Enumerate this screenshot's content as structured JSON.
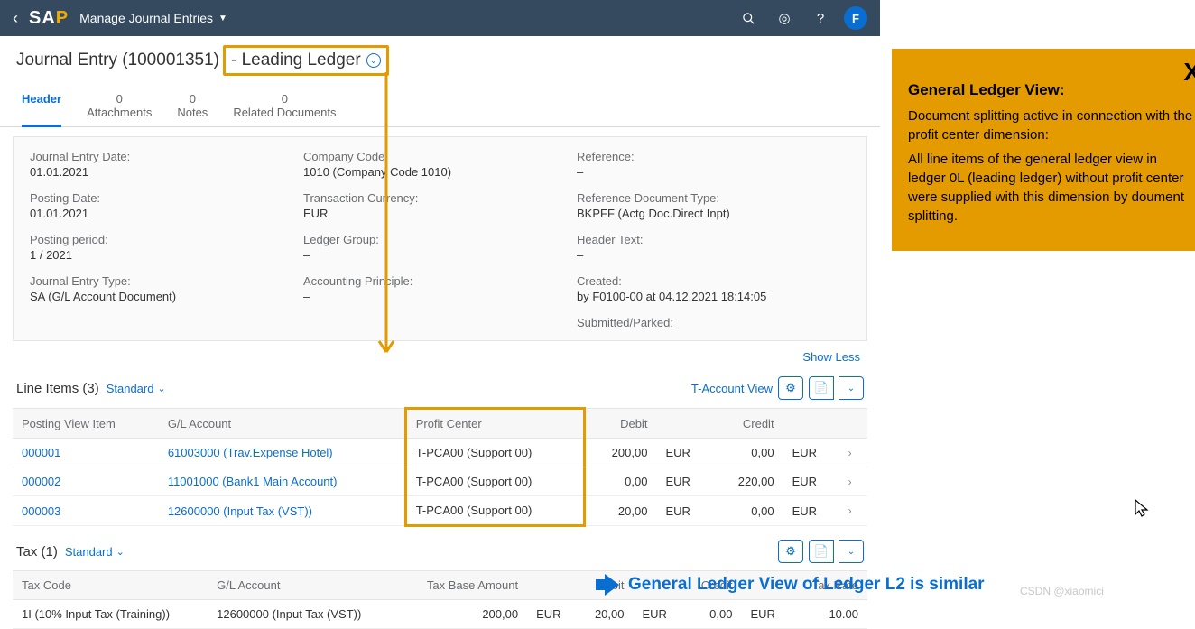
{
  "shell": {
    "app": "Manage Journal Entries",
    "avatar": "F"
  },
  "page": {
    "title_prefix": "Journal Entry (100001351)",
    "ledger": "- Leading Ledger"
  },
  "tabs": [
    {
      "label": "Header",
      "count": "",
      "active": true
    },
    {
      "label": "Attachments",
      "count": "0"
    },
    {
      "label": "Notes",
      "count": "0"
    },
    {
      "label": "Related Documents",
      "count": "0"
    }
  ],
  "header": [
    [
      {
        "lbl": "Journal Entry Date:",
        "val": "01.01.2021"
      },
      {
        "lbl": "Company Code:",
        "val": "1010 (Company Code 1010)"
      },
      {
        "lbl": "Reference:",
        "val": "–"
      }
    ],
    [
      {
        "lbl": "Posting Date:",
        "val": "01.01.2021"
      },
      {
        "lbl": "Transaction Currency:",
        "val": "EUR"
      },
      {
        "lbl": "Reference Document Type:",
        "val": "BKPFF (Actg Doc.Direct Inpt)"
      }
    ],
    [
      {
        "lbl": "Posting period:",
        "val": "1 / 2021"
      },
      {
        "lbl": "Ledger Group:",
        "val": "–"
      },
      {
        "lbl": "Header Text:",
        "val": "–"
      }
    ],
    [
      {
        "lbl": "Journal Entry Type:",
        "val": "SA (G/L Account Document)"
      },
      {
        "lbl": "Accounting Principle:",
        "val": "–"
      },
      {
        "lbl": "Created:",
        "val": "by F0100-00 at 04.12.2021 18:14:05",
        "link": true
      }
    ],
    [
      null,
      null,
      {
        "lbl": "Submitted/Parked:",
        "val": ""
      }
    ]
  ],
  "showless": "Show Less",
  "lineItems": {
    "title": "Line Items (3)",
    "variant": "Standard",
    "tAccount": "T-Account View",
    "cols": [
      "Posting View Item",
      "G/L Account",
      "Profit Center",
      "Debit",
      "",
      "Credit",
      "",
      ""
    ],
    "rows": [
      {
        "item": "000001",
        "gl": "61003000 (Trav.Expense Hotel)",
        "pc": "T-PCA00 (Support 00)",
        "debit": "200,00",
        "dcur": "EUR",
        "credit": "0,00",
        "ccur": "EUR"
      },
      {
        "item": "000002",
        "gl": "11001000 (Bank1 Main Account)",
        "pc": "T-PCA00 (Support 00)",
        "debit": "0,00",
        "dcur": "EUR",
        "credit": "220,00",
        "ccur": "EUR"
      },
      {
        "item": "000003",
        "gl": "12600000 (Input Tax (VST))",
        "pc": "T-PCA00 (Support 00)",
        "debit": "20,00",
        "dcur": "EUR",
        "credit": "0,00",
        "ccur": "EUR"
      }
    ]
  },
  "tax": {
    "title": "Tax (1)",
    "variant": "Standard",
    "cols": [
      "Tax Code",
      "G/L Account",
      "Tax Base Amount",
      "",
      "Debit",
      "",
      "Credit",
      "",
      "Tax Rate"
    ],
    "rows": [
      {
        "code": "1I (10% Input Tax (Training))",
        "gl": "12600000 (Input Tax (VST))",
        "base": "200,00",
        "bcur": "EUR",
        "debit": "20,00",
        "dcur": "EUR",
        "credit": "0,00",
        "ccur": "EUR",
        "rate": "10.00"
      }
    ]
  },
  "annotation": {
    "close": "X",
    "heading": "General Ledger View:",
    "p1": "Document splitting active in connection with the profit center  dimension:",
    "p2": "All line items of the general ledger view in ledger 0L (leading ledger) without profit center were supplied with this dimension by doument splitting."
  },
  "footer": "General Ledger View of Ledger L2 is similar",
  "watermark": "CSDN @xiaomici"
}
